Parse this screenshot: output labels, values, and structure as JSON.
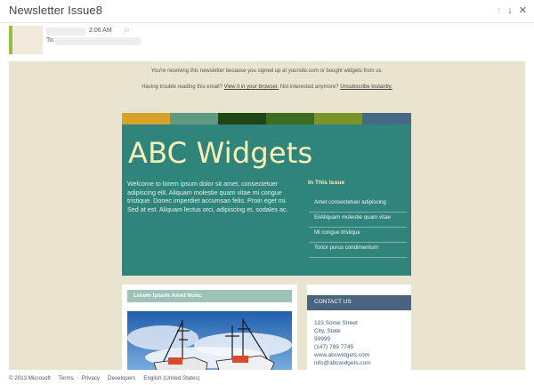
{
  "header": {
    "subject": "Newsletter Issue8",
    "icons": [
      "arrow-up-icon",
      "arrow-down-icon",
      "close-icon"
    ]
  },
  "sender": {
    "time": "2:06 AM",
    "to_label": "To:"
  },
  "email": {
    "preheader": "You're receiving this newsletter because you signed up at yoursite.com or bought widgets from us.",
    "trouble_text": "Having trouble reading this email?",
    "view_link": "View it in your browser.",
    "not_interested": "Not interested anymore?",
    "unsubscribe_link": "Unsubscribe Instantly.",
    "colors": [
      "#d8a12a",
      "#5f9a80",
      "#1f4613",
      "#3d6b1f",
      "#7a9429",
      "#466883"
    ],
    "hero": {
      "title": "ABC Widgets",
      "body": "Welcome to lorem ipsum dolor sit amet, consectetuer adipiscing elit. Aliquam molestie quam vitae mi congue tristique. Donec imperdiet accumsan felis. Proin eget mi. Sed at est. Aliquam lectus orci, adipiscing et, sodales ac.",
      "in_this_issue": "In This Issue",
      "issues": [
        "Amet consectetuer adipiscing",
        "EliAliquam molestie quam vitae",
        "Mi congue tristique",
        "Tortor purus condimentum"
      ]
    },
    "article": {
      "heading": "Lorem Ipsum Amet Nunc"
    },
    "contact": {
      "heading": "CONTACT US",
      "lines": [
        "123 Some Street",
        "City, State",
        "99999",
        "(147) 789 7745",
        "www.abcwidgets.com",
        "info@abcwidgets.com"
      ]
    }
  },
  "footer": {
    "copyright": "© 2013 Microsoft",
    "links": [
      "Terms",
      "Privacy",
      "Developers",
      "English (United States)"
    ]
  }
}
